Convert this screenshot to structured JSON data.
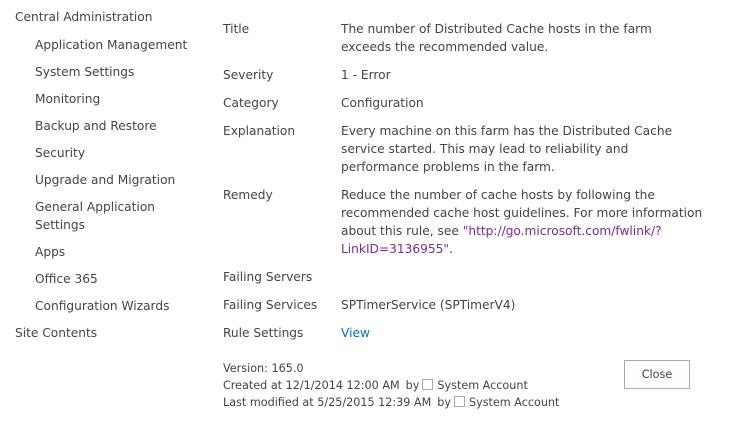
{
  "nav": {
    "top": "Central Administration",
    "items": [
      {
        "label": "Application Management"
      },
      {
        "label": "System Settings"
      },
      {
        "label": "Monitoring"
      },
      {
        "label": "Backup and Restore"
      },
      {
        "label": "Security"
      },
      {
        "label": "Upgrade and Migration"
      },
      {
        "label": "General Application Settings"
      },
      {
        "label": "Apps"
      },
      {
        "label": "Office 365"
      },
      {
        "label": "Configuration Wizards"
      }
    ],
    "bottom": "Site Contents"
  },
  "props": {
    "title": {
      "label": "Title",
      "value": "The number of Distributed Cache hosts in the farm exceeds the recommended value."
    },
    "severity": {
      "label": "Severity",
      "value": "1 - Error"
    },
    "category": {
      "label": "Category",
      "value": "Configuration"
    },
    "explanation": {
      "label": "Explanation",
      "value": "Every machine on this farm has the Distributed Cache service started. This may lead to reliability and performance problems in the farm."
    },
    "remedy": {
      "label": "Remedy",
      "text": "Reduce the number of cache hosts by following the recommended cache host guidelines. For more information about this rule, see",
      "link": "\"http://go.microsoft.com/fwlink/?LinkID=3136955\"",
      "suffix": "."
    },
    "failing_servers": {
      "label": "Failing Servers",
      "value": ""
    },
    "failing_services": {
      "label": "Failing Services",
      "value": "SPTimerService (SPTimerV4)"
    },
    "rule_settings": {
      "label": "Rule Settings",
      "value": "View"
    }
  },
  "footer": {
    "version": "Version: 165.0",
    "created": "Created at 12/1/2014 12:00 AM",
    "created_by_prefix": "by",
    "created_by": "System Account",
    "modified": "Last modified at 5/25/2015 12:39 AM",
    "modified_by_prefix": "by",
    "modified_by": "System Account"
  },
  "buttons": {
    "close": "Close"
  },
  "colors": {
    "link": "#0072c6",
    "visited_link": "#7a2b9b",
    "text": "#444444"
  }
}
